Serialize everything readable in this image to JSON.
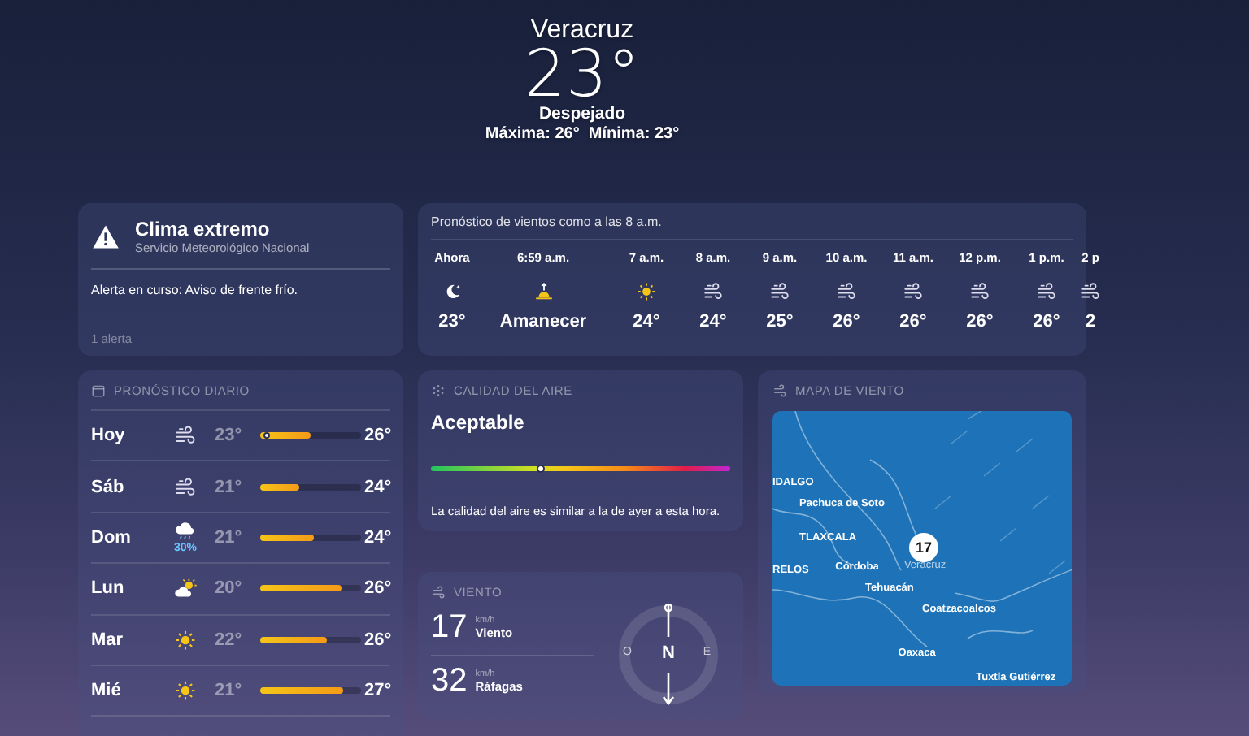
{
  "header": {
    "city": "Veracruz",
    "temperature": "23°",
    "condition": "Despejado",
    "high_low": "Máxima: 26°  Mínima: 23°"
  },
  "alert": {
    "title": "Clima extremo",
    "source": "Servicio Meteorológico Nacional",
    "message": "Alerta en curso: Aviso de frente frío.",
    "count": "1 alerta"
  },
  "hourly": {
    "title": "Pronóstico de vientos como a las 8 a.m.",
    "hours": [
      {
        "time": "Ahora",
        "kind": "moon",
        "value": "23°"
      },
      {
        "time": "6:59 a.m.",
        "kind": "sunrise",
        "value": "Amanecer"
      },
      {
        "time": "7 a.m.",
        "kind": "sun",
        "value": "24°"
      },
      {
        "time": "8 a.m.",
        "kind": "wind",
        "value": "24°"
      },
      {
        "time": "9 a.m.",
        "kind": "wind",
        "value": "25°"
      },
      {
        "time": "10 a.m.",
        "kind": "wind",
        "value": "26°"
      },
      {
        "time": "11 a.m.",
        "kind": "wind",
        "value": "26°"
      },
      {
        "time": "12 p.m.",
        "kind": "wind",
        "value": "26°"
      },
      {
        "time": "1 p.m.",
        "kind": "wind",
        "value": "26°"
      },
      {
        "time": "2 p",
        "kind": "wind",
        "value": "2"
      }
    ]
  },
  "daily": {
    "title": "PRONÓSTICO DIARIO",
    "rows": [
      {
        "day": "Hoy",
        "kind": "wind",
        "low": "23°",
        "high": "26°",
        "level": 0.5,
        "current": true
      },
      {
        "day": "Sáb",
        "kind": "wind",
        "low": "21°",
        "high": "24°",
        "level": 0.39,
        "current": false
      },
      {
        "day": "Dom",
        "kind": "rain",
        "precip": "30%",
        "low": "21°",
        "high": "24°",
        "level": 0.54,
        "current": false
      },
      {
        "day": "Lun",
        "kind": "partly_cloudy",
        "low": "20°",
        "high": "26°",
        "level": 0.8,
        "current": false
      },
      {
        "day": "Mar",
        "kind": "sun",
        "low": "22°",
        "high": "26°",
        "level": 0.66,
        "current": false
      },
      {
        "day": "Mié",
        "kind": "sun",
        "low": "21°",
        "high": "27°",
        "level": 0.83,
        "current": false
      }
    ]
  },
  "air_quality": {
    "title": "CALIDAD DEL AIRE",
    "rating": "Aceptable",
    "level": 0.37,
    "note": "La calidad del aire es similar a la de ayer a esta hora."
  },
  "wind": {
    "title": "VIENTO",
    "readings": [
      {
        "value": "17",
        "unit": "km/h",
        "label": "Viento"
      },
      {
        "value": "32",
        "unit": "km/h",
        "label": "Ráfagas"
      }
    ],
    "compass": {
      "center": "N",
      "west": "O",
      "east": "E"
    }
  },
  "wind_map": {
    "title": "MAPA DE VIENTO",
    "badge": "17",
    "places": [
      {
        "name": "IDALGO",
        "kind": "region"
      },
      {
        "name": "Pachuca de Soto",
        "kind": "city"
      },
      {
        "name": "TLAXCALA",
        "kind": "region"
      },
      {
        "name": "RELOS",
        "kind": "region"
      },
      {
        "name": "Córdoba",
        "kind": "city"
      },
      {
        "name": "Veracruz",
        "kind": "minor"
      },
      {
        "name": "Tehuacán",
        "kind": "city"
      },
      {
        "name": "Coatzacoalcos",
        "kind": "city"
      },
      {
        "name": "Oaxaca",
        "kind": "city"
      },
      {
        "name": "Tuxtla Gutiérrez",
        "kind": "city"
      }
    ]
  }
}
